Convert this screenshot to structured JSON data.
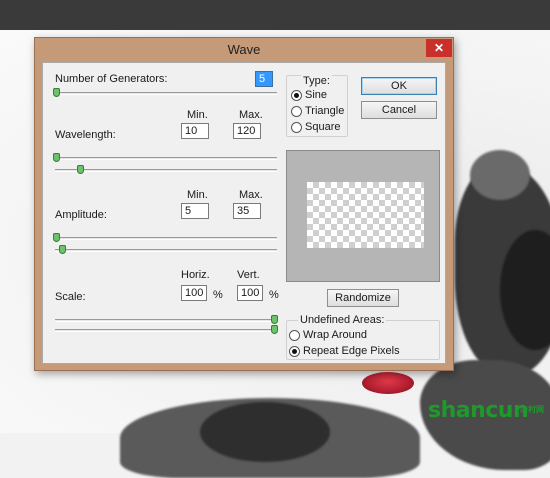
{
  "dialog": {
    "title": "Wave",
    "close_label": "✕"
  },
  "generators": {
    "label": "Number of Generators:",
    "value": "5"
  },
  "wavelength": {
    "label": "Wavelength:",
    "min_header": "Min.",
    "max_header": "Max.",
    "min": "10",
    "max": "120"
  },
  "amplitude": {
    "label": "Amplitude:",
    "min_header": "Min.",
    "max_header": "Max.",
    "min": "5",
    "max": "35"
  },
  "scale": {
    "label": "Scale:",
    "horiz_header": "Horiz.",
    "vert_header": "Vert.",
    "horiz": "100",
    "vert": "100",
    "unit": "%"
  },
  "type": {
    "title": "Type:",
    "options": [
      "Sine",
      "Triangle",
      "Square"
    ],
    "selected": "Sine"
  },
  "buttons": {
    "ok": "OK",
    "cancel": "Cancel",
    "randomize": "Randomize"
  },
  "undefined_areas": {
    "title": "Undefined Areas:",
    "options": [
      "Wrap Around",
      "Repeat Edge Pixels"
    ],
    "selected": "Repeat Edge Pixels"
  },
  "watermark": {
    "main": "shancun",
    "sub": "山村网"
  },
  "colors": {
    "title_bar": "#c49a78",
    "close_button": "#c9302c",
    "slider_thumb": "#6cc36c",
    "field_selection": "#3399ff",
    "watermark": "#1c9a2c"
  }
}
